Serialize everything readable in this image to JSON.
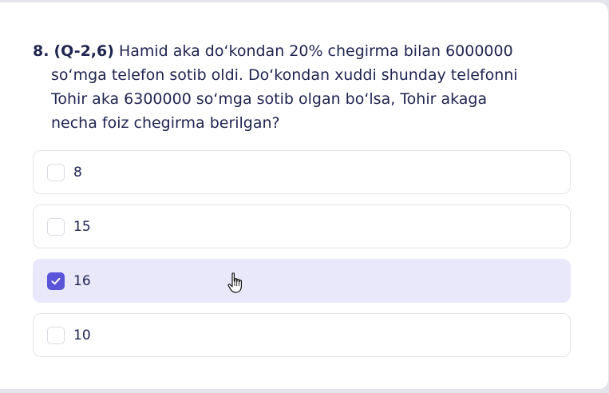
{
  "question": {
    "number": "8.",
    "code": "(Q-2,6)",
    "line1": "Hamid aka do‘kondan 20% chegirma bilan 6000000",
    "line2": "so‘mga telefon sotib oldi. Do‘kondan xuddi shunday telefonni",
    "line3": "Tohir aka 6300000 so‘mga sotib olgan bo‘lsa, Tohir akaga",
    "line4": "necha foiz chegirma berilgan?"
  },
  "options": [
    {
      "label": "8",
      "checked": false
    },
    {
      "label": "15",
      "checked": false
    },
    {
      "label": "16",
      "checked": true
    },
    {
      "label": "10",
      "checked": false
    }
  ],
  "colors": {
    "accent": "#5a55d8",
    "selected_bg": "#e8e8fa",
    "text": "#1f2450"
  },
  "icons": {
    "check": "check-icon",
    "cursor": "hand-pointer-icon"
  }
}
